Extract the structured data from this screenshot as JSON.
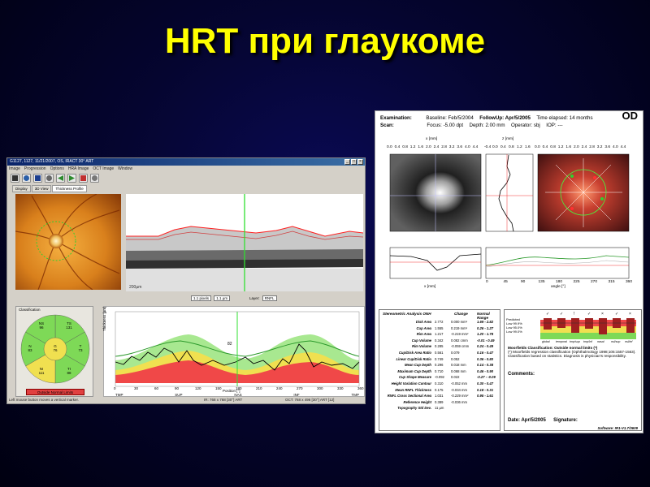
{
  "slide": {
    "title": "HRT при глаукоме"
  },
  "oct": {
    "window_title": "G1127, 1127, 11/21/2007, OS, IRACT 30° ART",
    "window_buttons": [
      "_",
      "□",
      "×"
    ],
    "menu": [
      "Image",
      "Progression",
      "Options",
      "HRA Image",
      "OCT Image",
      "Window"
    ],
    "toolbar_icons": [
      "open-icon",
      "info-icon",
      "save-icon",
      "print-icon",
      "back-icon",
      "forward-icon",
      "grid-icon",
      "settings-icon"
    ],
    "tabs": [
      "Display",
      "3D View",
      "Thickness Profile"
    ],
    "scan_mode_label": "1.1 pixels",
    "scan_mode_value": "1.1 µm",
    "layer_label": "Layer:",
    "layer_value": "RNFL",
    "classification": {
      "title": "Classification",
      "sectors": [
        {
          "id": "TS",
          "name": "TS",
          "value": "131"
        },
        {
          "id": "NS",
          "name": "NS",
          "value": "96"
        },
        {
          "id": "N",
          "name": "N",
          "value": "83"
        },
        {
          "id": "NI",
          "name": "NI",
          "value": "111"
        },
        {
          "id": "TI",
          "name": "TI",
          "value": "88"
        },
        {
          "id": "T",
          "name": "T",
          "value": "73"
        },
        {
          "id": "G",
          "name": "G",
          "value": "76"
        }
      ],
      "status": "Outside Normal Limits"
    },
    "thickness_axis_labels": [
      "TMP",
      "SUP",
      "NAS",
      "INF",
      "TMP"
    ],
    "thickness_x_ticks": [
      "0",
      "30",
      "60",
      "90",
      "120",
      "150",
      "180",
      "210",
      "240",
      "270",
      "300",
      "330",
      "360"
    ],
    "thickness_y_label": "Thickness [µm]",
    "thickness_x_label": "Position [°]",
    "marker_value": "82",
    "status_left": "Left mouse button moves a vertical marker.",
    "status_mid": "IR: 768 x 768 [30°] ART",
    "status_right": "OCT: 768 x 496 [30°] ART [12]",
    "colors": {
      "normal": "#7ed957",
      "borderline": "#f0e050",
      "outside": "#f04848"
    }
  },
  "hrt": {
    "eye": "OD",
    "examination_label": "Examination:",
    "baseline": "Baseline: Feb/5/2004",
    "followup": "FollowUp: Apr/5/2005",
    "elapsed": "Time elapsed: 14 months",
    "scan_label": "Scan:",
    "focus": "Focus: -5.00 dpt",
    "depth": "Depth: 2.00 mm",
    "operator": "Operator: sbj",
    "iop": "IOP: ---",
    "x_axis_ticks": [
      "0.0",
      "0.4",
      "0.8",
      "1.2",
      "1.6",
      "2.0",
      "2.4",
      "2.8",
      "3.2",
      "3.6",
      "4.0",
      "4.4"
    ],
    "z_axis_ticks": [
      "-0.4",
      "0.0",
      "0.4",
      "0.8",
      "1.2",
      "1.6"
    ],
    "x_label": "x [mm]",
    "z_label": "z [mm]",
    "y_label": "y [mm]",
    "angle_ticks": [
      "0",
      "45",
      "90",
      "135",
      "180",
      "225",
      "270",
      "315",
      "360"
    ],
    "angle_label": "angle [°]",
    "table": {
      "title": "Stereometric Analysis ONH",
      "col_change": "Change",
      "col_range": "Normal Range",
      "rows": [
        {
          "name": "Disk Area",
          "base": "2.772",
          "change": "0.000 mm²",
          "range": "1.69 - 2.82"
        },
        {
          "name": "Cup Area",
          "base": "1.555",
          "change": "0.219 mm²",
          "range": "0.26 - 1.27"
        },
        {
          "name": "Rim Area",
          "base": "1.217",
          "change": "-0.219 mm²",
          "range": "1.20 - 1.78"
        },
        {
          "name": "Cup Volume",
          "base": "0.342",
          "change": "0.082 cmm",
          "range": "-0.01 - 0.49"
        },
        {
          "name": "Rim Volume",
          "base": "0.285",
          "change": "-0.059 cmm",
          "range": "0.24 - 0.49"
        },
        {
          "name": "Cup/Disk Area Ratio",
          "base": "0.561",
          "change": "0.079",
          "range": "0.16 - 0.47"
        },
        {
          "name": "Linear Cup/Disk Ratio",
          "base": "0.749",
          "change": "0.052",
          "range": "0.36 - 0.80"
        },
        {
          "name": "Mean Cup Depth",
          "base": "0.296",
          "change": "0.018 mm",
          "range": "0.14 - 0.38"
        },
        {
          "name": "Maximum Cup Depth",
          "base": "0.710",
          "change": "0.068 mm",
          "range": "0.46 - 0.90"
        },
        {
          "name": "Cup Shape Measure",
          "base": "-0.092",
          "change": "0.022",
          "range": "-0.27 - -0.09"
        },
        {
          "name": "Height Variation Contour",
          "base": "0.310",
          "change": "-0.052 mm",
          "range": "0.30 - 0.47"
        },
        {
          "name": "Mean RNFL Thickness",
          "base": "0.175",
          "change": "-0.034 mm",
          "range": "0.18 - 0.31"
        },
        {
          "name": "RNFL Cross Sectional Area",
          "base": "1.031",
          "change": "-0.229 mm²",
          "range": "0.95 - 1.61"
        },
        {
          "name": "Reference Height",
          "base": "0.389",
          "change": "-0.036 mm",
          "range": ""
        },
        {
          "name": "Topography Std Dev.",
          "base": "11 µm",
          "change": "",
          "range": ""
        }
      ]
    },
    "moorfields_bars": {
      "labels": [
        "global",
        "temporal",
        "tmp/sup",
        "tmp/inf",
        "nasal",
        "nsl/sup",
        "nsl/inf"
      ],
      "legend": [
        "Predicted",
        "Low 99.9%",
        "Low 95.0%",
        "Low 99.0%"
      ],
      "marks": [
        "✓",
        "✓",
        "!",
        "✓",
        "×",
        "✓",
        "×"
      ]
    },
    "moorfields_title": "Moorfields Classification: Outside normal limits (*)",
    "moorfields_note": "(*) Moorfields regression classification (Ophthalmology 1998;105:1557-1563). Classification based on statistics. Diagnosis is physician's responsibility.",
    "comments_label": "Comments:",
    "date_label": "Date: Apr/5/2005",
    "signature_label": "Signature:",
    "software": "Software: IR1-V1.7/3609"
  }
}
